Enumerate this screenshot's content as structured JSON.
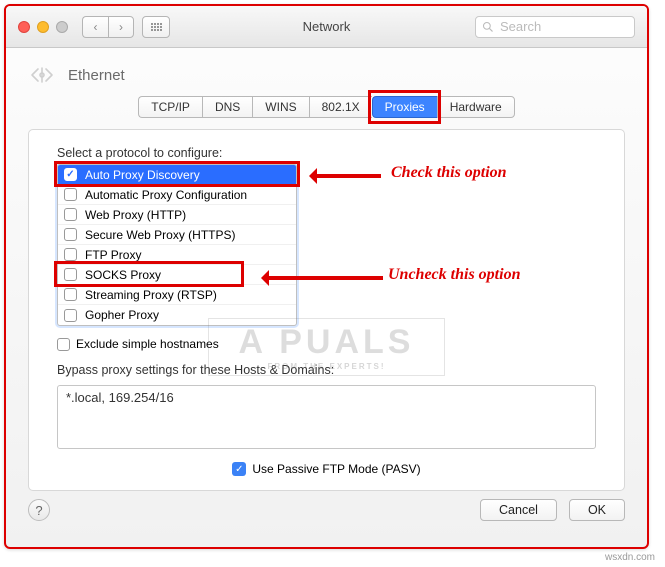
{
  "window": {
    "title": "Network"
  },
  "search": {
    "placeholder": "Search"
  },
  "breadcrumb": {
    "label": "Ethernet"
  },
  "tabs": {
    "tcpip": "TCP/IP",
    "dns": "DNS",
    "wins": "WINS",
    "8021x": "802.1X",
    "proxies": "Proxies",
    "hardware": "Hardware"
  },
  "panel": {
    "select_label": "Select a protocol to configure:",
    "protocols": {
      "auto_discovery": "Auto Proxy Discovery",
      "auto_config": "Automatic Proxy Configuration",
      "web_proxy": "Web Proxy (HTTP)",
      "secure_web_proxy": "Secure Web Proxy (HTTPS)",
      "ftp_proxy": "FTP Proxy",
      "socks_proxy": "SOCKS Proxy",
      "streaming_proxy": "Streaming Proxy (RTSP)",
      "gopher_proxy": "Gopher Proxy"
    },
    "exclude_label": "Exclude simple hostnames",
    "bypass_label": "Bypass proxy settings for these Hosts & Domains:",
    "bypass_value": "*.local, 169.254/16",
    "pasv_label": "Use Passive FTP Mode (PASV)"
  },
  "footer": {
    "cancel": "Cancel",
    "ok": "OK"
  },
  "annotations": {
    "check_text": "Check this option",
    "uncheck_text": "Uncheck this option"
  },
  "watermark": {
    "brand": "A   PUALS",
    "tagline": "FROM THE EXPERTS!"
  },
  "credit": "wsxdn.com"
}
